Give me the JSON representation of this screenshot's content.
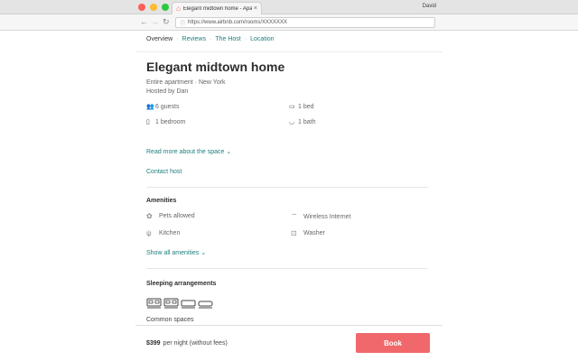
{
  "browser": {
    "tab_title": "Elegant midtown home - Apart",
    "tab_close": "×",
    "user": "David",
    "url": "https://www.airbnb.com/rooms/XXXXXXX"
  },
  "subnav": {
    "items": [
      "Overview",
      "Reviews",
      "The Host",
      "Location"
    ]
  },
  "listing": {
    "title": "Elegant midtown home",
    "type": "Entire apartment · New York",
    "host": "Hosted by Dan",
    "facts": {
      "guests": "6 guests",
      "bedrooms": "1 bedroom",
      "beds": "1 bed",
      "baths": "1 bath"
    },
    "read_more": "Read more about the space",
    "contact": "Contact host"
  },
  "amenities": {
    "title": "Amenities",
    "items": [
      "Pets allowed",
      "Wireless Internet",
      "Kitchen",
      "Washer"
    ],
    "show_all": "Show all amenities"
  },
  "sleeping": {
    "title": "Sleeping arrangements",
    "common": "Common spaces"
  },
  "footer": {
    "price": "$399",
    "price_note": "per night (without fees)",
    "book": "Book"
  },
  "colors": {
    "accent_link": "#1e7f7e",
    "book_button": "#f0686b"
  }
}
